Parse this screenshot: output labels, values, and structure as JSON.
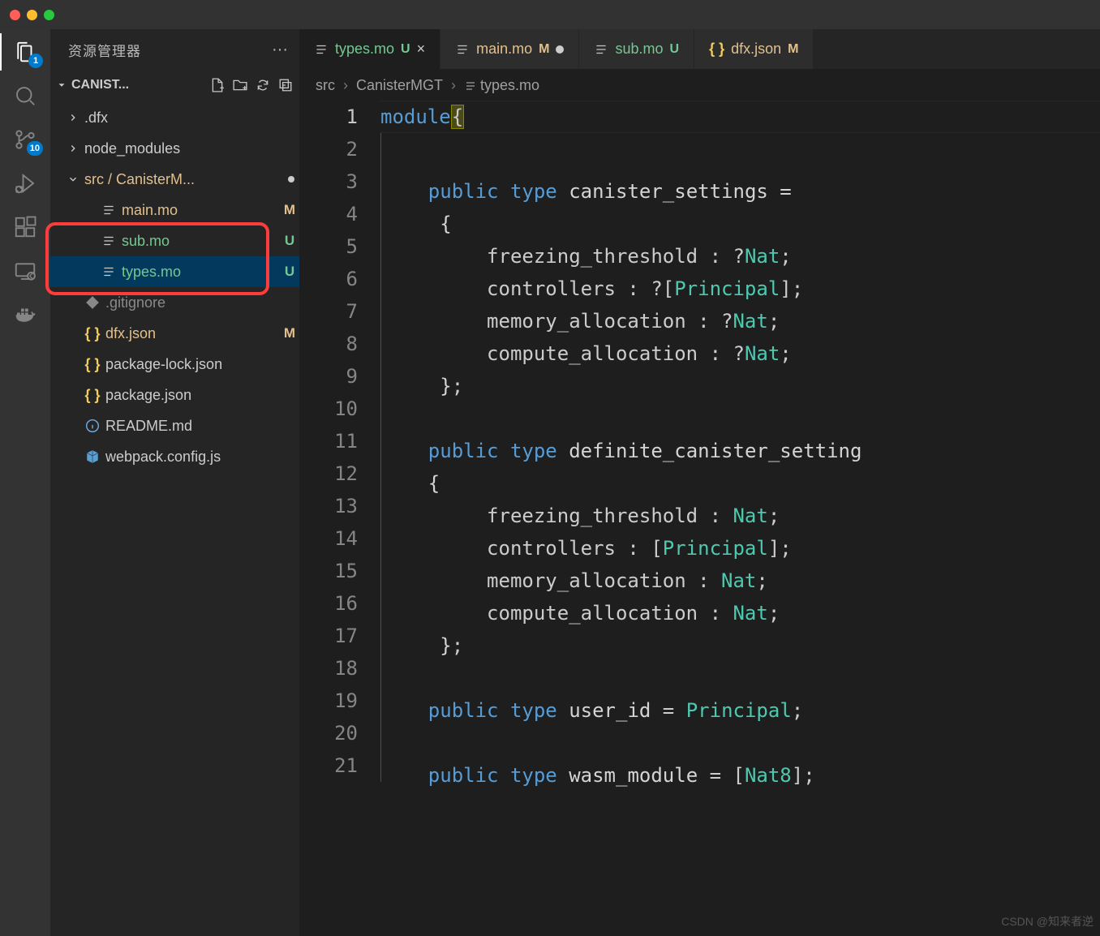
{
  "activity_bar": {
    "explorer_badge": "1",
    "scm_badge": "10"
  },
  "sidebar": {
    "title": "资源管理器",
    "folder_name": "CANIST...",
    "items": [
      {
        "kind": "folder",
        "label": ".dfx",
        "expanded": false,
        "status": "",
        "indent": 0
      },
      {
        "kind": "folder",
        "label": "node_modules",
        "expanded": false,
        "status": "",
        "indent": 0
      },
      {
        "kind": "folder",
        "label": "src / CanisterM...",
        "expanded": true,
        "status": "dot",
        "color": "git-m",
        "indent": 0
      },
      {
        "kind": "file",
        "label": "main.mo",
        "status": "M",
        "color": "git-m",
        "icon": "lines",
        "indent": 1
      },
      {
        "kind": "file",
        "label": "sub.mo",
        "status": "U",
        "color": "git-u",
        "icon": "lines",
        "indent": 1
      },
      {
        "kind": "file",
        "label": "types.mo",
        "status": "U",
        "color": "git-u",
        "icon": "lines",
        "indent": 1,
        "selected": true
      },
      {
        "kind": "file",
        "label": ".gitignore",
        "status": "",
        "color": "git-normal",
        "icon": "git",
        "indent": 0,
        "dimmed": true
      },
      {
        "kind": "file",
        "label": "dfx.json",
        "status": "M",
        "color": "git-m",
        "icon": "json",
        "indent": 0
      },
      {
        "kind": "file",
        "label": "package-lock.json",
        "status": "",
        "color": "git-normal",
        "icon": "json",
        "indent": 0
      },
      {
        "kind": "file",
        "label": "package.json",
        "status": "",
        "color": "git-normal",
        "icon": "json",
        "indent": 0
      },
      {
        "kind": "file",
        "label": "README.md",
        "status": "",
        "color": "git-normal",
        "icon": "info",
        "indent": 0
      },
      {
        "kind": "file",
        "label": "webpack.config.js",
        "status": "",
        "color": "git-normal",
        "icon": "cube",
        "indent": 0
      }
    ]
  },
  "tabs": [
    {
      "name": "types.mo",
      "mark": "U",
      "mark_color": "git-u",
      "active": true,
      "close": true
    },
    {
      "name": "main.mo",
      "mark": "M",
      "mark_color": "git-m",
      "active": false,
      "dirty": true
    },
    {
      "name": "sub.mo",
      "mark": "U",
      "mark_color": "git-u",
      "active": false
    },
    {
      "name": "dfx.json",
      "mark": "M",
      "mark_color": "git-m",
      "active": false,
      "json": true
    }
  ],
  "breadcrumbs": [
    {
      "label": "src"
    },
    {
      "label": "CanisterMGT"
    },
    {
      "label": "types.mo",
      "icon": true
    }
  ],
  "code": {
    "lines": [
      {
        "n": 1,
        "html": "<span class='tok-key'>module</span><span class='brace-hl'>{</span>"
      },
      {
        "n": 2,
        "html": ""
      },
      {
        "n": 3,
        "html": "    <span class='tok-key'>public</span> <span class='tok-key'>type</span> <span class='tok-def'>canister_settings</span> <span class='tok-punct'>=</span>"
      },
      {
        "n": 4,
        "html": "     <span class='tok-brace'>{</span>"
      },
      {
        "n": 5,
        "html": "         freezing_threshold : ?<span class='tok-type'>Nat</span>;"
      },
      {
        "n": 6,
        "html": "         controllers : ?[<span class='tok-type'>Principal</span>];"
      },
      {
        "n": 7,
        "html": "         memory_allocation : ?<span class='tok-type'>Nat</span>;"
      },
      {
        "n": 8,
        "html": "         compute_allocation : ?<span class='tok-type'>Nat</span>;"
      },
      {
        "n": 9,
        "html": "     <span class='tok-brace'>}</span>;"
      },
      {
        "n": 10,
        "html": ""
      },
      {
        "n": 11,
        "html": "    <span class='tok-key'>public</span> <span class='tok-key'>type</span> <span class='tok-def'>definite_canister_setting</span>"
      },
      {
        "n": 12,
        "html": "    <span class='tok-brace'>{</span>"
      },
      {
        "n": 13,
        "html": "         freezing_threshold : <span class='tok-type'>Nat</span>;"
      },
      {
        "n": 14,
        "html": "         controllers : [<span class='tok-type'>Principal</span>];"
      },
      {
        "n": 15,
        "html": "         memory_allocation : <span class='tok-type'>Nat</span>;"
      },
      {
        "n": 16,
        "html": "         compute_allocation : <span class='tok-type'>Nat</span>;"
      },
      {
        "n": 17,
        "html": "     <span class='tok-brace'>}</span>;"
      },
      {
        "n": 18,
        "html": ""
      },
      {
        "n": 19,
        "html": "    <span class='tok-key'>public</span> <span class='tok-key'>type</span> <span class='tok-def'>user_id</span> = <span class='tok-type'>Principal</span>;"
      },
      {
        "n": 20,
        "html": ""
      },
      {
        "n": 21,
        "html": "    <span class='tok-key'>public</span> <span class='tok-key'>type</span> <span class='tok-def'>wasm_module</span> = [<span class='tok-type'>Nat8</span>];"
      }
    ]
  },
  "watermark": "CSDN @知来者逆"
}
